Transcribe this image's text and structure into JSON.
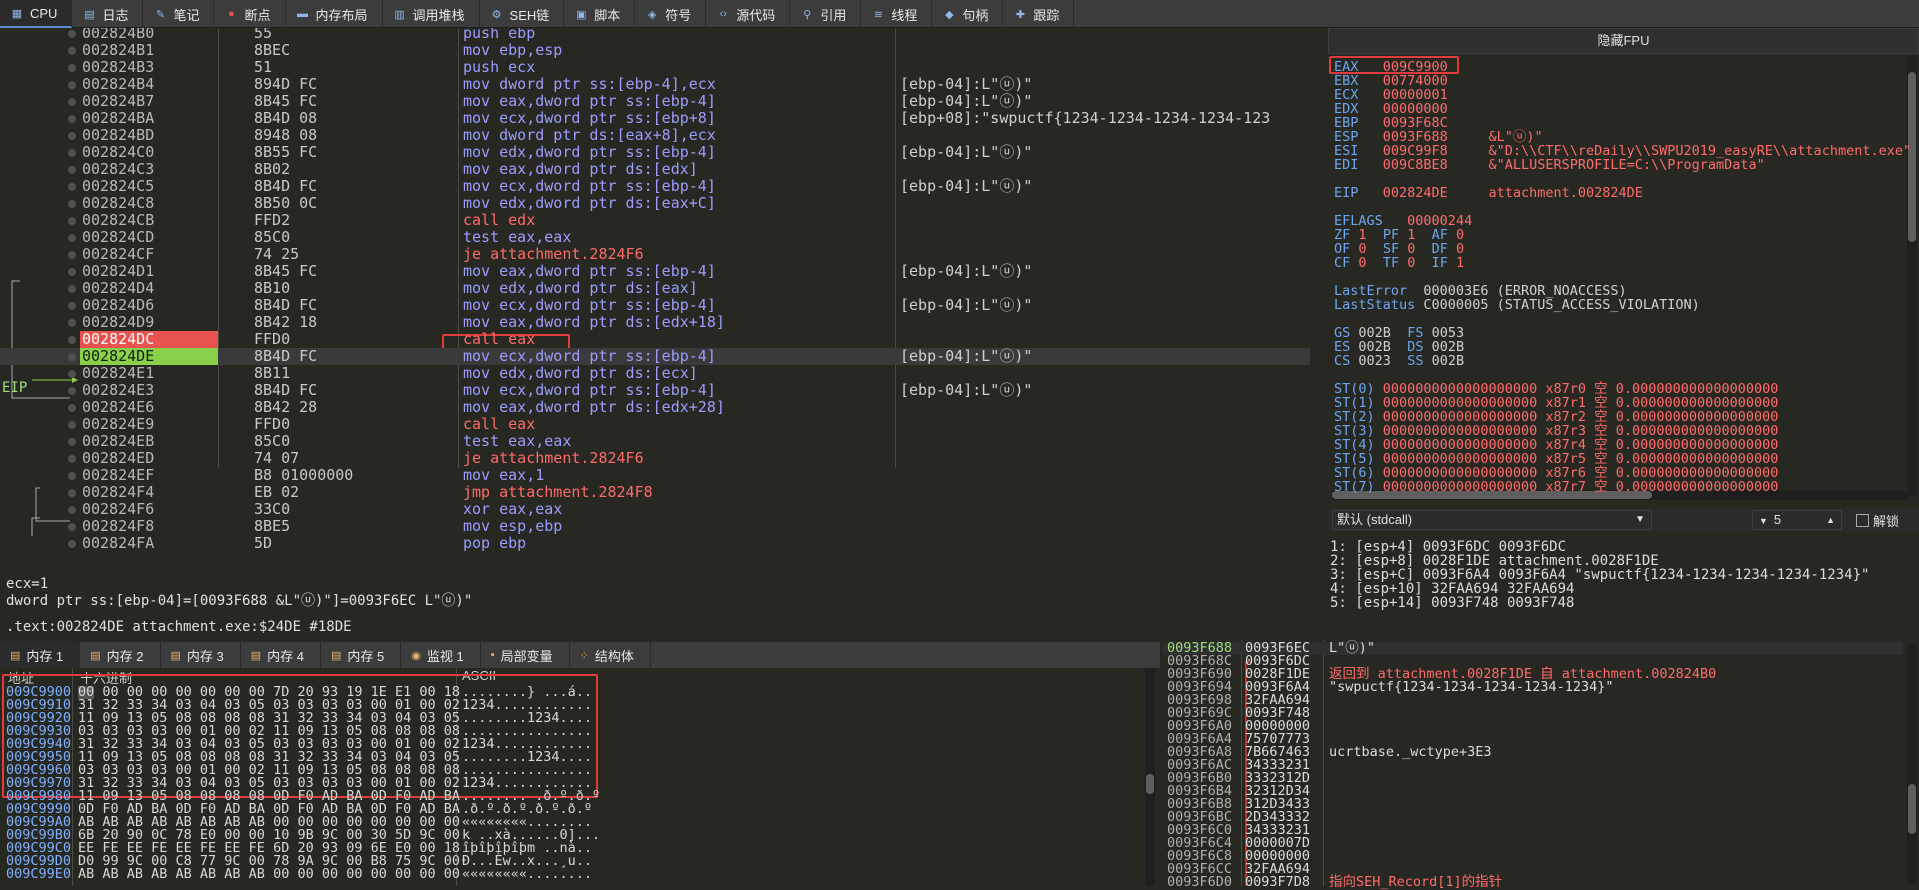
{
  "tabs": [
    {
      "label": "CPU",
      "icon": "cpu-icon"
    },
    {
      "label": "日志",
      "icon": "log-icon"
    },
    {
      "label": "笔记",
      "icon": "notes-icon"
    },
    {
      "label": "断点",
      "icon": "breakpoint-icon"
    },
    {
      "label": "内存布局",
      "icon": "memory-map-icon"
    },
    {
      "label": "调用堆栈",
      "icon": "call-stack-icon"
    },
    {
      "label": "SEH链",
      "icon": "seh-icon"
    },
    {
      "label": "脚本",
      "icon": "script-icon"
    },
    {
      "label": "符号",
      "icon": "symbols-icon"
    },
    {
      "label": "源代码",
      "icon": "source-icon"
    },
    {
      "label": "引用",
      "icon": "references-icon"
    },
    {
      "label": "线程",
      "icon": "threads-icon"
    },
    {
      "label": "句柄",
      "icon": "handles-icon"
    },
    {
      "label": "跟踪",
      "icon": "trace-icon"
    }
  ],
  "eip_label": "EIP",
  "disasm": [
    {
      "addr": "002824B0",
      "bytes": "55",
      "ins": "push ebp",
      "cmt": ""
    },
    {
      "addr": "002824B1",
      "bytes": "8BEC",
      "ins": "mov ebp,esp",
      "cmt": ""
    },
    {
      "addr": "002824B3",
      "bytes": "51",
      "ins": "push ecx",
      "cmt": ""
    },
    {
      "addr": "002824B4",
      "bytes": "894D FC",
      "ins": "mov dword ptr ss:[ebp-4],ecx",
      "cmt": "[ebp-04]:L\"ⓤ)\""
    },
    {
      "addr": "002824B7",
      "bytes": "8B45 FC",
      "ins": "mov eax,dword ptr ss:[ebp-4]",
      "cmt": "[ebp-04]:L\"ⓤ)\""
    },
    {
      "addr": "002824BA",
      "bytes": "8B4D 08",
      "ins": "mov ecx,dword ptr ss:[ebp+8]",
      "cmt": "[ebp+08]:\"swpuctf{1234-1234-1234-1234-123"
    },
    {
      "addr": "002824BD",
      "bytes": "8948 08",
      "ins": "mov dword ptr ds:[eax+8],ecx",
      "cmt": ""
    },
    {
      "addr": "002824C0",
      "bytes": "8B55 FC",
      "ins": "mov edx,dword ptr ss:[ebp-4]",
      "cmt": "[ebp-04]:L\"ⓤ)\""
    },
    {
      "addr": "002824C3",
      "bytes": "8B02",
      "ins": "mov eax,dword ptr ds:[edx]",
      "cmt": ""
    },
    {
      "addr": "002824C5",
      "bytes": "8B4D FC",
      "ins": "mov ecx,dword ptr ss:[ebp-4]",
      "cmt": "[ebp-04]:L\"ⓤ)\""
    },
    {
      "addr": "002824C8",
      "bytes": "8B50 0C",
      "ins": "mov edx,dword ptr ds:[eax+C]",
      "cmt": ""
    },
    {
      "addr": "002824CB",
      "bytes": "FFD2",
      "ins": "call edx",
      "cmt": ""
    },
    {
      "addr": "002824CD",
      "bytes": "85C0",
      "ins": "test eax,eax",
      "cmt": ""
    },
    {
      "addr": "002824CF",
      "bytes": "74 25",
      "ins": "je attachment.2824F6",
      "cmt": ""
    },
    {
      "addr": "002824D1",
      "bytes": "8B45 FC",
      "ins": "mov eax,dword ptr ss:[ebp-4]",
      "cmt": "[ebp-04]:L\"ⓤ)\""
    },
    {
      "addr": "002824D4",
      "bytes": "8B10",
      "ins": "mov edx,dword ptr ds:[eax]",
      "cmt": ""
    },
    {
      "addr": "002824D6",
      "bytes": "8B4D FC",
      "ins": "mov ecx,dword ptr ss:[ebp-4]",
      "cmt": "[ebp-04]:L\"ⓤ)\""
    },
    {
      "addr": "002824D9",
      "bytes": "8B42 18",
      "ins": "mov eax,dword ptr ds:[edx+18]",
      "cmt": ""
    },
    {
      "addr": "002824DC",
      "bytes": "FFD0",
      "ins": "call eax",
      "cmt": ""
    },
    {
      "addr": "002824DE",
      "bytes": "8B4D FC",
      "ins": "mov ecx,dword ptr ss:[ebp-4]",
      "cmt": "[ebp-04]:L\"ⓤ)\""
    },
    {
      "addr": "002824E1",
      "bytes": "8B11",
      "ins": "mov edx,dword ptr ds:[ecx]",
      "cmt": ""
    },
    {
      "addr": "002824E3",
      "bytes": "8B4D FC",
      "ins": "mov ecx,dword ptr ss:[ebp-4]",
      "cmt": "[ebp-04]:L\"ⓤ)\""
    },
    {
      "addr": "002824E6",
      "bytes": "8B42 28",
      "ins": "mov eax,dword ptr ds:[edx+28]",
      "cmt": ""
    },
    {
      "addr": "002824E9",
      "bytes": "FFD0",
      "ins": "call eax",
      "cmt": ""
    },
    {
      "addr": "002824EB",
      "bytes": "85C0",
      "ins": "test eax,eax",
      "cmt": ""
    },
    {
      "addr": "002824ED",
      "bytes": "74 07",
      "ins": "je attachment.2824F6",
      "cmt": ""
    },
    {
      "addr": "002824EF",
      "bytes": "B8 01000000",
      "ins": "mov eax,1",
      "cmt": ""
    },
    {
      "addr": "002824F4",
      "bytes": "EB 02",
      "ins": "jmp attachment.2824F8",
      "cmt": ""
    },
    {
      "addr": "002824F6",
      "bytes": "33C0",
      "ins": "xor eax,eax",
      "cmt": ""
    },
    {
      "addr": "002824F8",
      "bytes": "8BE5",
      "ins": "mov esp,ebp",
      "cmt": ""
    },
    {
      "addr": "002824FA",
      "bytes": "5D",
      "ins": "pop ebp",
      "cmt": ""
    }
  ],
  "info": {
    "line1": "ecx=1",
    "line2": "dword ptr ss:[ebp-04]=[0093F688 &L\"ⓤ)\"]=0093F6EC L\"ⓤ)\"",
    "line3": ".text:002824DE attachment.exe:$24DE #18DE"
  },
  "regs": {
    "header": "隐藏FPU",
    "gp": [
      {
        "n": "EAX",
        "v": "009C9900",
        "d": ""
      },
      {
        "n": "EBX",
        "v": "00774000",
        "d": ""
      },
      {
        "n": "ECX",
        "v": "00000001",
        "d": ""
      },
      {
        "n": "EDX",
        "v": "00000000",
        "d": ""
      },
      {
        "n": "EBP",
        "v": "0093F68C",
        "d": ""
      },
      {
        "n": "ESP",
        "v": "0093F688",
        "d": "&L\"ⓤ)\""
      },
      {
        "n": "ESI",
        "v": "009C99F8",
        "d": "&\"D:\\\\CTF\\\\reDaily\\\\SWPU2019_easyRE\\\\attachment.exe\""
      },
      {
        "n": "EDI",
        "v": "009C8BE8",
        "d": "&\"ALLUSERSPROFILE=C:\\\\ProgramData\""
      }
    ],
    "eip": {
      "n": "EIP",
      "v": "002824DE",
      "d": "attachment.002824DE"
    },
    "eflags": {
      "n": "EFLAGS",
      "v": "00000244"
    },
    "flags": [
      [
        "ZF",
        "1",
        "PF",
        "1",
        "AF",
        "0"
      ],
      [
        "OF",
        "0",
        "SF",
        "0",
        "DF",
        "0"
      ],
      [
        "CF",
        "0",
        "TF",
        "0",
        "IF",
        "1"
      ]
    ],
    "lasterror": {
      "n": "LastError",
      "v": "000003E6 (ERROR_NOACCESS)"
    },
    "laststatus": {
      "n": "LastStatus",
      "v": "C0000005 (STATUS_ACCESS_VIOLATION)"
    },
    "segs": [
      [
        "GS",
        "002B",
        "FS",
        "0053"
      ],
      [
        "ES",
        "002B",
        "DS",
        "002B"
      ],
      [
        "CS",
        "0023",
        "SS",
        "002B"
      ]
    ],
    "st": [
      {
        "n": "ST(0)",
        "v": "0000000000000000000",
        "t": "x87r0 空",
        "f": "0.000000000000000000"
      },
      {
        "n": "ST(1)",
        "v": "0000000000000000000",
        "t": "x87r1 空",
        "f": "0.000000000000000000"
      },
      {
        "n": "ST(2)",
        "v": "0000000000000000000",
        "t": "x87r2 空",
        "f": "0.000000000000000000"
      },
      {
        "n": "ST(3)",
        "v": "0000000000000000000",
        "t": "x87r3 空",
        "f": "0.000000000000000000"
      },
      {
        "n": "ST(4)",
        "v": "0000000000000000000",
        "t": "x87r4 空",
        "f": "0.000000000000000000"
      },
      {
        "n": "ST(5)",
        "v": "0000000000000000000",
        "t": "x87r5 空",
        "f": "0.000000000000000000"
      },
      {
        "n": "ST(6)",
        "v": "0000000000000000000",
        "t": "x87r6 空",
        "f": "0.000000000000000000"
      },
      {
        "n": "ST(7)",
        "v": "0000000000000000000",
        "t": "x87r7 空",
        "f": "0.000000000000000000"
      }
    ]
  },
  "callconv": {
    "selected": "默认 (stdcall)",
    "count": "5",
    "unlock": "解锁"
  },
  "callstack": [
    "1: [esp+4] 0093F6DC 0093F6DC",
    "2: [esp+8] 0028F1DE attachment.0028F1DE",
    "3: [esp+C] 0093F6A4 0093F6A4 \"swpuctf{1234-1234-1234-1234-1234}\"",
    "4: [esp+10] 32FAA694 32FAA694",
    "5: [esp+14] 0093F748 0093F748"
  ],
  "btabs": [
    {
      "label": "内存 1",
      "icon": "memory-icon"
    },
    {
      "label": "内存 2",
      "icon": "memory-icon"
    },
    {
      "label": "内存 3",
      "icon": "memory-icon"
    },
    {
      "label": "内存 4",
      "icon": "memory-icon"
    },
    {
      "label": "内存 5",
      "icon": "memory-icon"
    },
    {
      "label": "监视 1",
      "icon": "watch-icon"
    },
    {
      "label": "局部变量",
      "icon": "locals-icon"
    },
    {
      "label": "结构体",
      "icon": "struct-icon"
    }
  ],
  "dump": {
    "h_addr": "地址",
    "h_hex": "十六进制",
    "h_asc": "ASCII",
    "rows": [
      {
        "a": "009C9900",
        "h": "00 00 00 00 00 00 00 00 7D 20 93 19 1E E1 00 18",
        "s": "........} ...á.."
      },
      {
        "a": "009C9910",
        "h": "31 32 33 34 03 04 03 05 03 03 03 03 00 01 00 02",
        "s": "1234............"
      },
      {
        "a": "009C9920",
        "h": "11 09 13 05 08 08 08 08 31 32 33 34 03 04 03 05",
        "s": "........1234...."
      },
      {
        "a": "009C9930",
        "h": "03 03 03 03 00 01 00 02 11 09 13 05 08 08 08 08",
        "s": "................"
      },
      {
        "a": "009C9940",
        "h": "31 32 33 34 03 04 03 05 03 03 03 03 00 01 00 02",
        "s": "1234............"
      },
      {
        "a": "009C9950",
        "h": "11 09 13 05 08 08 08 08 31 32 33 34 03 04 03 05",
        "s": "........1234...."
      },
      {
        "a": "009C9960",
        "h": "03 03 03 03 00 01 00 02 11 09 13 05 08 08 08 08",
        "s": "................"
      },
      {
        "a": "009C9970",
        "h": "31 32 33 34 03 04 03 05 03 03 03 03 00 01 00 02",
        "s": "1234............"
      },
      {
        "a": "009C9980",
        "h": "11 09 13 05 08 08 08 08 0D F0 AD BA 0D F0 AD BA",
        "s": "........ .ð.º.ð.º"
      },
      {
        "a": "009C9990",
        "h": "0D F0 AD BA 0D F0 AD BA 0D F0 AD BA 0D F0 AD BA",
        "s": ".ð.º.ð.º.ð.º.ð.º"
      },
      {
        "a": "009C99A0",
        "h": "AB AB AB AB AB AB AB AB 00 00 00 00 00 00 00 00",
        "s": "««««««««........"
      },
      {
        "a": "009C99B0",
        "h": "6B 20 90 0C 78 E0 00 00 10 9B 9C 00 30 5D 9C 00",
        "s": "k ..xà......0]..."
      },
      {
        "a": "009C99C0",
        "h": "EE FE EE FE EE FE EE FE 6D 20 93 09 6E E0 00 18",
        "s": "îþîþîþîþm ..nà.."
      },
      {
        "a": "009C99D0",
        "h": "D0 99 9C 00 C8 77 9C 00 78 9A 9C 00 B8 75 9C 00",
        "s": "Ð...Èw..x...¸u.."
      },
      {
        "a": "009C99E0",
        "h": "AB AB AB AB AB AB AB AB 00 00 00 00 00 00 00 00",
        "s": "««««««««........"
      }
    ]
  },
  "stack": [
    {
      "a": "0093F688",
      "v": "0093F6EC",
      "c": "L\"ⓤ)\""
    },
    {
      "a": "0093F68C",
      "v": "0093F6DC",
      "c": ""
    },
    {
      "a": "0093F690",
      "v": "0028F1DE",
      "c": "返回到 attachment.0028F1DE 自 attachment.002824B0"
    },
    {
      "a": "0093F694",
      "v": "0093F6A4",
      "c": "\"swpuctf{1234-1234-1234-1234-1234}\""
    },
    {
      "a": "0093F698",
      "v": "32FAA694",
      "c": ""
    },
    {
      "a": "0093F69C",
      "v": "0093F748",
      "c": ""
    },
    {
      "a": "0093F6A0",
      "v": "00000000",
      "c": ""
    },
    {
      "a": "0093F6A4",
      "v": "75707773",
      "c": ""
    },
    {
      "a": "0093F6A8",
      "v": "7B667463",
      "c": "ucrtbase._wctype+3E3"
    },
    {
      "a": "0093F6AC",
      "v": "34333231",
      "c": ""
    },
    {
      "a": "0093F6B0",
      "v": "3332312D",
      "c": ""
    },
    {
      "a": "0093F6B4",
      "v": "32312D34",
      "c": ""
    },
    {
      "a": "0093F6B8",
      "v": "312D3433",
      "c": ""
    },
    {
      "a": "0093F6BC",
      "v": "2D343332",
      "c": ""
    },
    {
      "a": "0093F6C0",
      "v": "34333231",
      "c": ""
    },
    {
      "a": "0093F6C4",
      "v": "0000007D",
      "c": ""
    },
    {
      "a": "0093F6C8",
      "v": "00000000",
      "c": ""
    },
    {
      "a": "0093F6CC",
      "v": "32FAA694",
      "c": ""
    },
    {
      "a": "0093F6D0",
      "v": "0093F7D8",
      "c": "指向SEH_Record[1]的指针"
    }
  ],
  "colors": {
    "accent": "#e23b3b",
    "eip_green": "#8bd04a",
    "bp_red": "#e8534f"
  }
}
